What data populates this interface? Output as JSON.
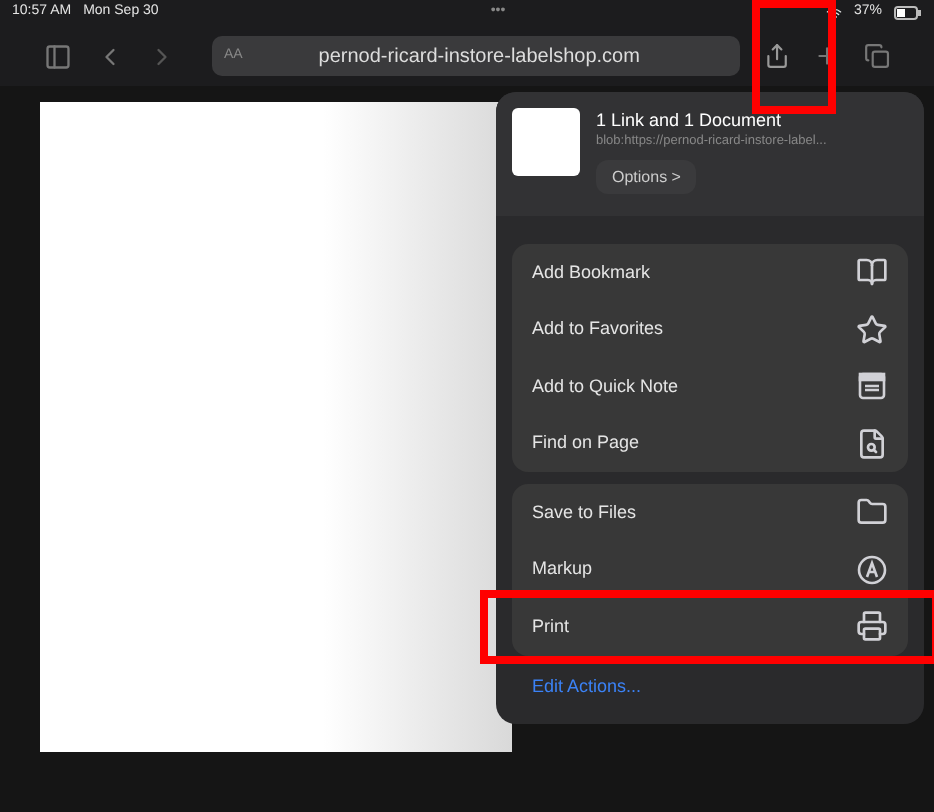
{
  "status_bar": {
    "time": "10:57 AM",
    "date": "Mon Sep 30",
    "dots": "•••",
    "battery": "37%"
  },
  "toolbar": {
    "text_size": "AA",
    "url": "pernod-ricard-instore-labelshop.com"
  },
  "share_sheet": {
    "title": "1 Link and 1 Document",
    "subtitle": "blob:https://pernod-ricard-instore-label...",
    "options": "Options >",
    "groups": [
      {
        "items": [
          {
            "label": "Add Bookmark",
            "highlighted": false
          },
          {
            "label": "Add to Favorites",
            "highlighted": false
          },
          {
            "label": "Add to Quick Note",
            "highlighted": false
          },
          {
            "label": "Find on Page",
            "highlighted": false
          }
        ]
      },
      {
        "items": [
          {
            "label": "Save to Files",
            "highlighted": false
          },
          {
            "label": "Markup",
            "highlighted": false
          },
          {
            "label": "Print",
            "highlighted": true
          }
        ]
      }
    ],
    "edit_actions": "Edit Actions..."
  },
  "annotations": {
    "share_button_highlighted": true
  }
}
